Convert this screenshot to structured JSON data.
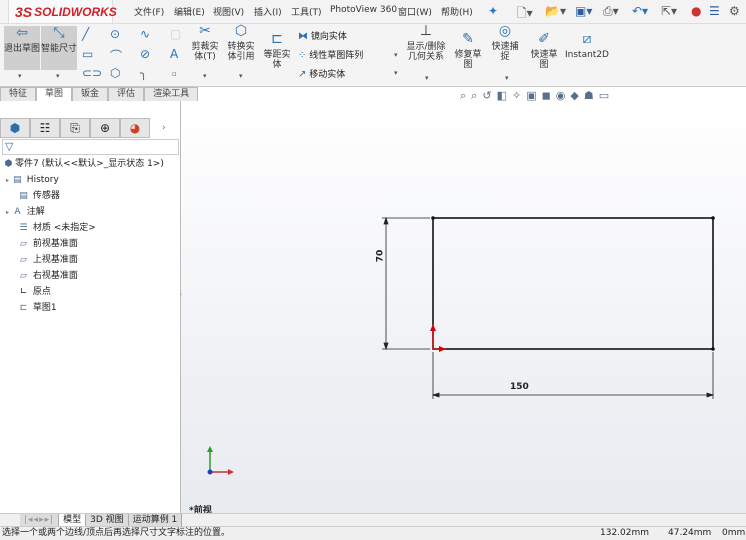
{
  "app": {
    "logo": "SOLIDWORKS",
    "logo_prefix": "3S"
  },
  "menu": [
    "文件(F)",
    "编辑(E)",
    "视图(V)",
    "插入(I)",
    "工具(T)",
    "PhotoView 360",
    "窗口(W)",
    "帮助(H)"
  ],
  "quick_access": [
    "new-icon",
    "open-icon",
    "save-icon",
    "print-icon",
    "undo-icon",
    "select-icon",
    "rebuild-icon",
    "file-properties-icon",
    "options-icon"
  ],
  "ribbon": {
    "exit_sketch": "退出草图",
    "smart_dimension": "智能尺寸",
    "trim": "剪裁实体(T)",
    "convert": "转换实体引用",
    "offset": "等距实体",
    "mirror": "镜向实体",
    "linear_pattern": "线性草图阵列",
    "move": "移动实体",
    "relations": "显示/删除几何关系",
    "repair": "修复草图",
    "quick_snap": "快速捕捉",
    "rapid_sketch": "快速草图",
    "instant2d": "Instant2D"
  },
  "tabs": [
    "特征",
    "草图",
    "钣金",
    "评估",
    "渲染工具"
  ],
  "active_tab": "草图",
  "tree": {
    "root": "零件7  (默认<<默认>_显示状态 1>)",
    "items": [
      "History",
      "传感器",
      "注解",
      "材质 <未指定>",
      "前视基准面",
      "上视基准面",
      "右视基准面",
      "原点",
      "草图1"
    ]
  },
  "sketch": {
    "dim_vertical": "70",
    "dim_horizontal": "150",
    "view_label": "*前视"
  },
  "bottom_tabs": [
    "模型",
    "3D 视图",
    "运动算例 1"
  ],
  "status": {
    "message": "选择一个或两个边线/顶点后再选择尺寸文字标注的位置。",
    "x": "132.02mm",
    "y": "47.24mm",
    "z": "0mm"
  }
}
